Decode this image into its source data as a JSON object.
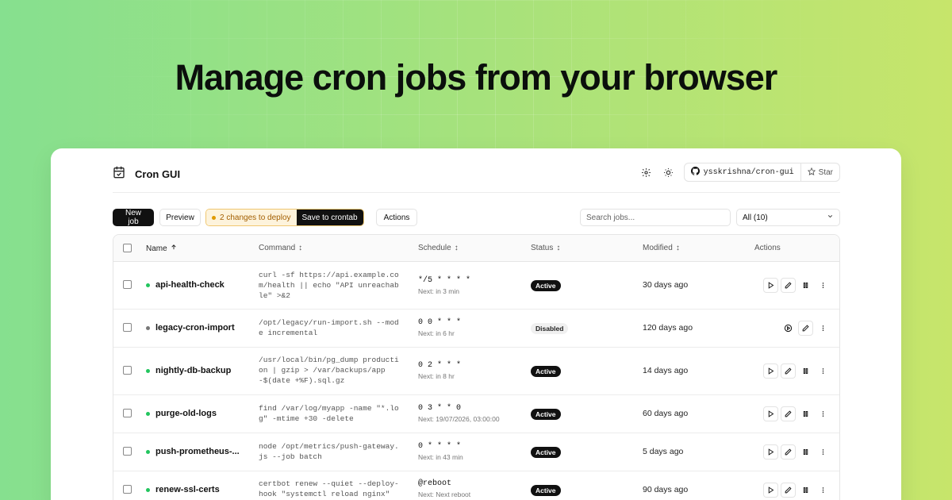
{
  "headline": "Manage cron jobs from your browser",
  "app": {
    "name": "Cron GUI"
  },
  "github": {
    "repo": "ysskrishna/cron-gui",
    "star_label": "Star"
  },
  "toolbar": {
    "new_job": "New job",
    "preview": "Preview",
    "pending_changes": "2 changes to deploy",
    "save": "Save to crontab",
    "actions": "Actions",
    "search_placeholder": "Search jobs...",
    "filter_value": "All (10)"
  },
  "table": {
    "headers": {
      "name": "Name",
      "command": "Command",
      "schedule": "Schedule",
      "status": "Status",
      "modified": "Modified",
      "actions": "Actions"
    },
    "rows": [
      {
        "name": "api-health-check",
        "command": "curl -sf https://api.example.com/health || echo \"API unreachable\" >&2",
        "schedule": "*/5 * * * *",
        "next": "Next: in 3 min",
        "status": "Active",
        "modified": "30 days ago",
        "enabled": true
      },
      {
        "name": "legacy-cron-import",
        "command": "/opt/legacy/run-import.sh --mode incremental",
        "schedule": "0 0 * * *",
        "next": "Next: in 6 hr",
        "status": "Disabled",
        "modified": "120 days ago",
        "enabled": false
      },
      {
        "name": "nightly-db-backup",
        "command": "/usr/local/bin/pg_dump production | gzip > /var/backups/app-$(date +%F).sql.gz",
        "schedule": "0 2 * * *",
        "next": "Next: in 8 hr",
        "status": "Active",
        "modified": "14 days ago",
        "enabled": true
      },
      {
        "name": "purge-old-logs",
        "command": "find /var/log/myapp -name \"*.log\" -mtime +30 -delete",
        "schedule": "0 3 * * 0",
        "next": "Next: 19/07/2026, 03:00:00",
        "status": "Active",
        "modified": "60 days ago",
        "enabled": true
      },
      {
        "name": "push-prometheus-...",
        "command": "node /opt/metrics/push-gateway.js --job batch",
        "schedule": "0 * * * *",
        "next": "Next: in 43 min",
        "status": "Active",
        "modified": "5 days ago",
        "enabled": true
      },
      {
        "name": "renew-ssl-certs",
        "command": "certbot renew --quiet --deploy-hook \"systemctl reload nginx\"",
        "schedule": "@reboot",
        "next": "Next: Next reboot",
        "status": "Active",
        "modified": "90 days ago",
        "enabled": true
      }
    ]
  },
  "colors": {
    "active_dot": "#22c55e",
    "disabled_dot": "#777777",
    "pending_dot": "#e09a00"
  }
}
